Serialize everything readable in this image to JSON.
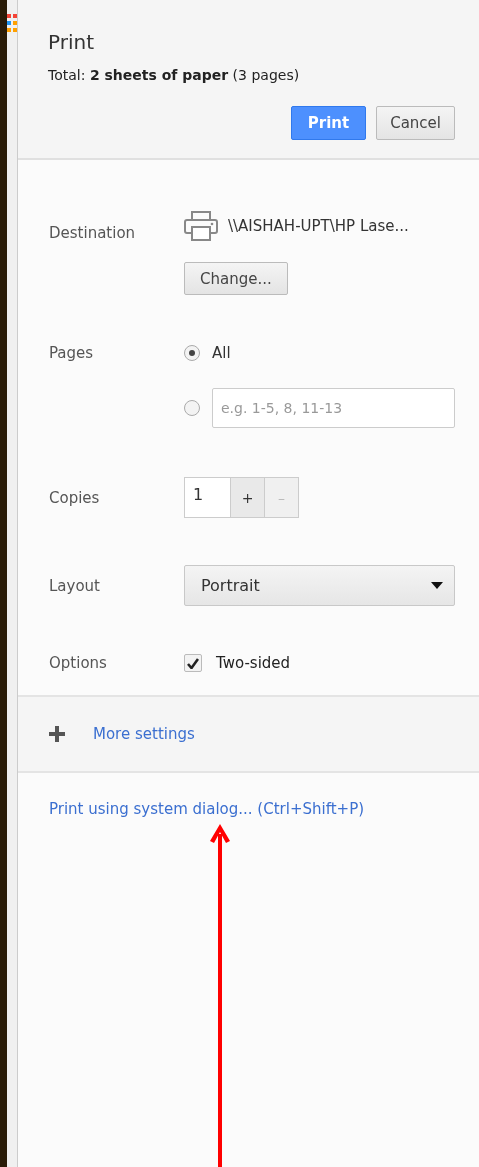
{
  "dialog": {
    "title": "Print",
    "summary": "Total: **2 sheets of paper** (3 pages)",
    "buttons": [
      {
        "label": "Print",
        "kind": "primary"
      },
      {
        "label": "Cancel",
        "kind": "default"
      }
    ]
  },
  "settings": [
    {
      "kind": "destination",
      "label": "Destination",
      "printer": "\\\\AISHAH-UPT\\HP Lase...",
      "button": "Change..."
    },
    {
      "kind": "radio",
      "label": "Pages",
      "options": [
        {
          "label": "All",
          "selected": true
        },
        {
          "placeholder": "e.g. 1-5, 8, 11-13",
          "selected": false
        }
      ]
    },
    {
      "kind": "copies",
      "label": "Copies",
      "value": "1",
      "increment": {
        "label": "+",
        "disabled": false
      },
      "decrement": {
        "label": "–",
        "disabled": true
      }
    },
    {
      "kind": "select",
      "label": "Layout",
      "value": "Portrait"
    },
    {
      "kind": "checkbox",
      "label": "Options",
      "option": "Two-sided",
      "checked": true
    }
  ],
  "more_settings": {
    "label": "More settings"
  },
  "system_dialog_link": "Print using system dialog... (Ctrl+Shift+P)"
}
